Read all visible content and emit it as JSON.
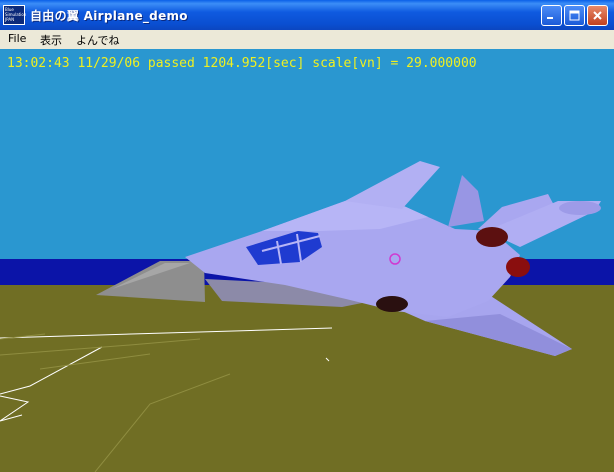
{
  "window": {
    "title": "自由の翼  Airplane_demo",
    "icon_text": "Blue\nSimulation\nJPAN"
  },
  "menu": {
    "items": [
      "File",
      "表示",
      "よんでね"
    ]
  },
  "hud": {
    "status_line": "13:02:43 11/29/06 passed 1204.952[sec] scale[vn] = 29.000000"
  },
  "colors": {
    "sky": "#2a97d0",
    "sea": "#0b14a8",
    "ground": "#706e24",
    "hud_text": "#f0f020",
    "aircraft_body": "#a9a7f0",
    "canopy": "#1f3bd0",
    "nose_cone": "#8e8e8e"
  },
  "icons": [
    "app-icon",
    "minimize-icon",
    "maximize-icon",
    "close-icon"
  ]
}
